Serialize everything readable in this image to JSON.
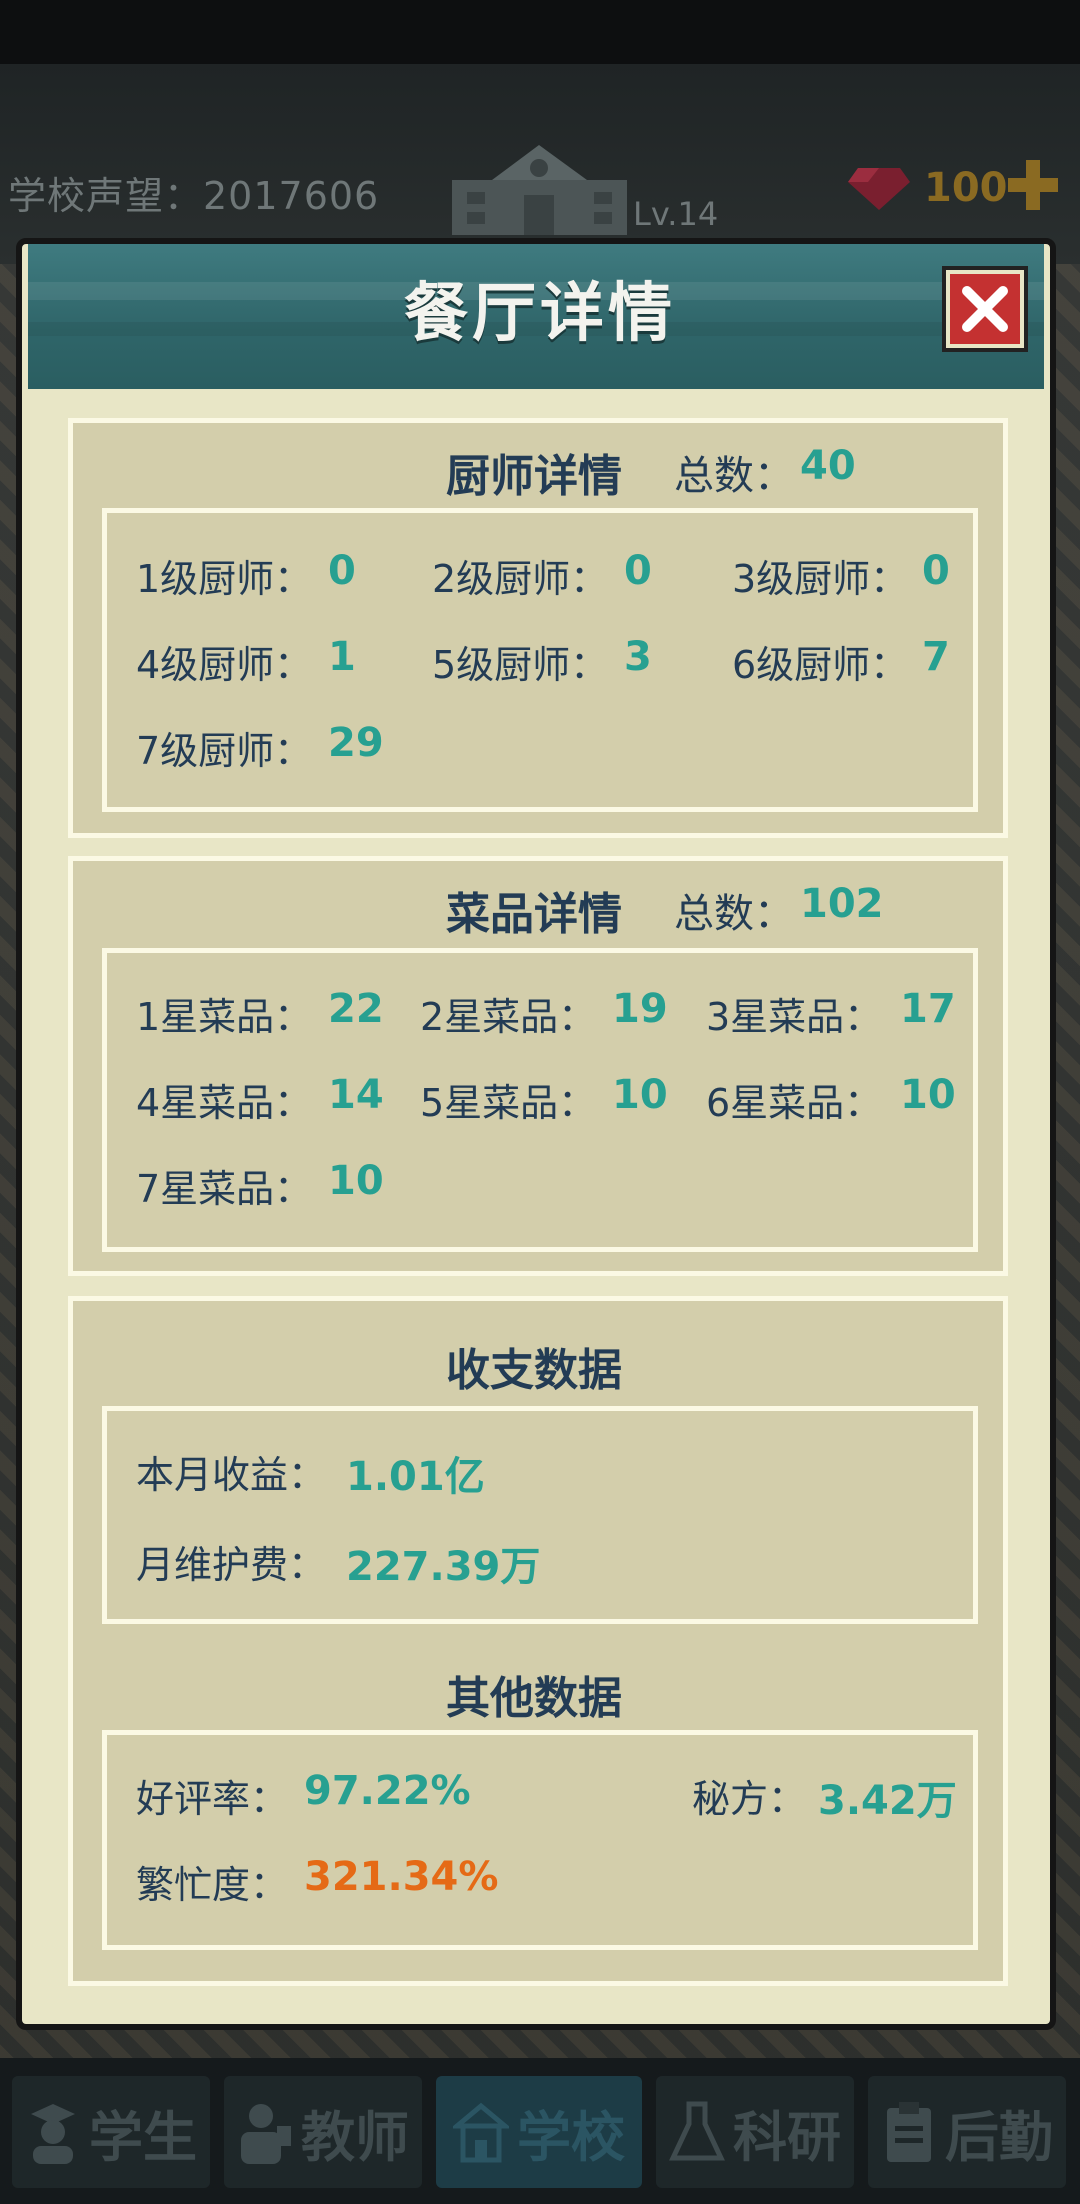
{
  "topbar": {
    "reputation": "学校声望：2017606",
    "school_level": "Lv.14",
    "gems": "100"
  },
  "modal": {
    "title": "餐厅详情",
    "chefs": {
      "title": "厨师详情",
      "total_label": "总数：",
      "total_value": "40",
      "items": [
        {
          "label": "1级厨师：",
          "value": "0"
        },
        {
          "label": "2级厨师：",
          "value": "0"
        },
        {
          "label": "3级厨师：",
          "value": "0"
        },
        {
          "label": "4级厨师：",
          "value": "1"
        },
        {
          "label": "5级厨师：",
          "value": "3"
        },
        {
          "label": "6级厨师：",
          "value": "7"
        },
        {
          "label": "7级厨师：",
          "value": "29"
        }
      ]
    },
    "dishes": {
      "title": "菜品详情",
      "total_label": "总数：",
      "total_value": "102",
      "items": [
        {
          "label": "1星菜品：",
          "value": "22"
        },
        {
          "label": "2星菜品：",
          "value": "19"
        },
        {
          "label": "3星菜品：",
          "value": "17"
        },
        {
          "label": "4星菜品：",
          "value": "14"
        },
        {
          "label": "5星菜品：",
          "value": "10"
        },
        {
          "label": "6星菜品：",
          "value": "10"
        },
        {
          "label": "7星菜品：",
          "value": "10"
        }
      ]
    },
    "finance": {
      "title": "收支数据",
      "income_label": "本月收益：",
      "income_value": "1.01亿",
      "upkeep_label": "月维护费：",
      "upkeep_value": "227.39万"
    },
    "other": {
      "title": "其他数据",
      "rating_label": "好评率：",
      "rating_value": "97.22%",
      "recipe_label": "秘方：",
      "recipe_value": "3.42万",
      "busy_label": "繁忙度：",
      "busy_value": "321.34%"
    }
  },
  "nav": {
    "tabs": [
      {
        "label": "学生",
        "icon": "student-icon"
      },
      {
        "label": "教师",
        "icon": "teacher-icon"
      },
      {
        "label": "学校",
        "icon": "school-icon",
        "active": true
      },
      {
        "label": "科研",
        "icon": "flask-icon"
      },
      {
        "label": "后勤",
        "icon": "clipboard-icon"
      }
    ]
  },
  "colors": {
    "accent_value": "#27a091",
    "warning_value": "#e56a16",
    "text": "#233c55",
    "header": "#2f6569",
    "close": "#c43131"
  }
}
